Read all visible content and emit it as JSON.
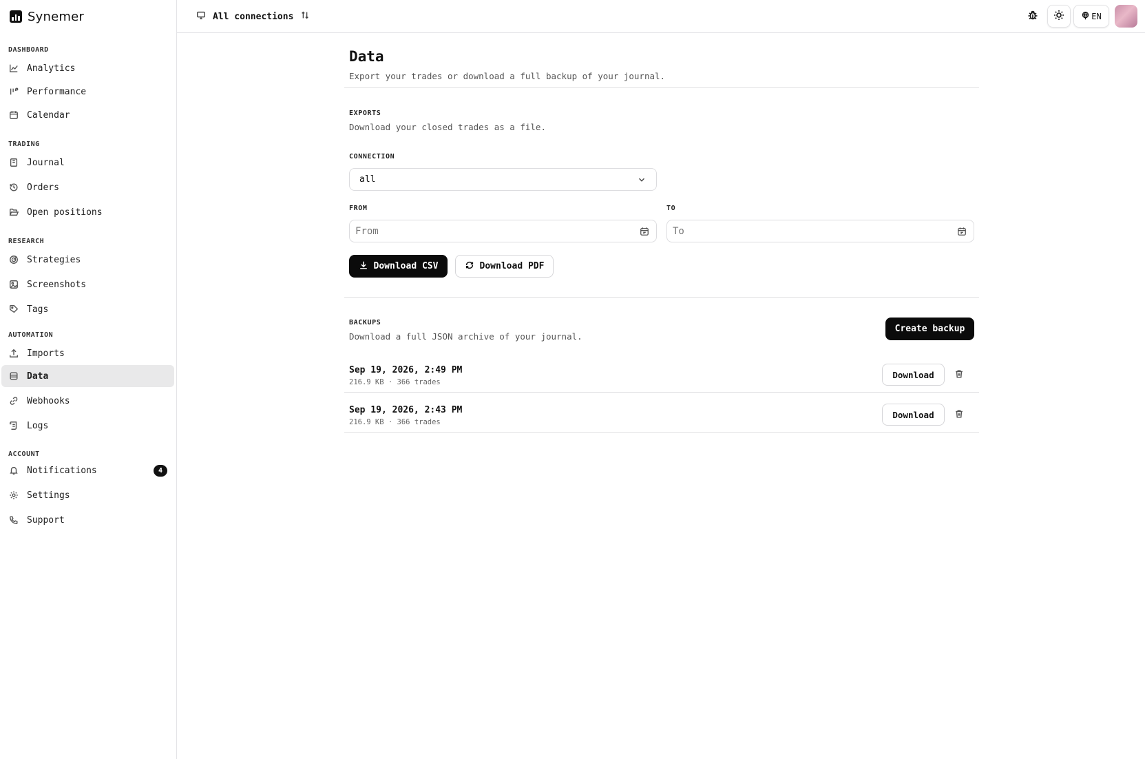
{
  "brand": {
    "name": "Synemer",
    "logo_icon": "bar-chart-logo"
  },
  "sidebar": {
    "sections": [
      {
        "label": "DASHBOARD",
        "items": [
          {
            "label": "Analytics",
            "icon": "line-chart-icon"
          },
          {
            "label": "Performance",
            "icon": "bar-gauge-icon"
          },
          {
            "label": "Calendar",
            "icon": "calendar-icon"
          }
        ]
      },
      {
        "label": "TRADING",
        "items": [
          {
            "label": "Journal",
            "icon": "notebook-icon"
          },
          {
            "label": "Orders",
            "icon": "history-icon"
          },
          {
            "label": "Open positions",
            "icon": "folder-open-icon"
          }
        ]
      },
      {
        "label": "RESEARCH",
        "items": [
          {
            "label": "Strategies",
            "icon": "target-icon"
          },
          {
            "label": "Screenshots",
            "icon": "image-icon"
          },
          {
            "label": "Tags",
            "icon": "tag-icon"
          }
        ]
      },
      {
        "label": "AUTOMATION",
        "items": [
          {
            "label": "Imports",
            "icon": "upload-icon"
          },
          {
            "label": "Data",
            "icon": "database-icon",
            "active": true
          },
          {
            "label": "Webhooks",
            "icon": "link-icon"
          },
          {
            "label": "Logs",
            "icon": "scroll-icon"
          }
        ]
      },
      {
        "label": "ACCOUNT",
        "items": [
          {
            "label": "Notifications",
            "icon": "bell-icon",
            "badge": "4"
          },
          {
            "label": "Settings",
            "icon": "gear-icon"
          },
          {
            "label": "Support",
            "icon": "phone-icon"
          }
        ]
      }
    ]
  },
  "topbar": {
    "connection_label": "All connections",
    "language": "EN"
  },
  "page": {
    "title": "Data",
    "subtitle": "Export your trades or download a full backup of your journal."
  },
  "exports": {
    "heading": "EXPORTS",
    "description": "Download your closed trades as a file.",
    "connection_label": "CONNECTION",
    "connection_value": "all",
    "from_label": "FROM",
    "from_placeholder": "From",
    "to_label": "TO",
    "to_placeholder": "To",
    "csv_button": "Download CSV",
    "pdf_button": "Download PDF"
  },
  "backups": {
    "heading": "BACKUPS",
    "description": "Download a full JSON archive of your journal.",
    "create_button": "Create backup",
    "download_label": "Download",
    "items": [
      {
        "date": "Sep 19, 2026, 2:49 PM",
        "meta": "216.9 KB · 366 trades"
      },
      {
        "date": "Sep 19, 2026, 2:43 PM",
        "meta": "216.9 KB · 366 trades"
      }
    ]
  },
  "colors": {
    "accent": "#0b0b0b",
    "active_bg": "#e9e9ea",
    "border": "#e4e4e7"
  }
}
